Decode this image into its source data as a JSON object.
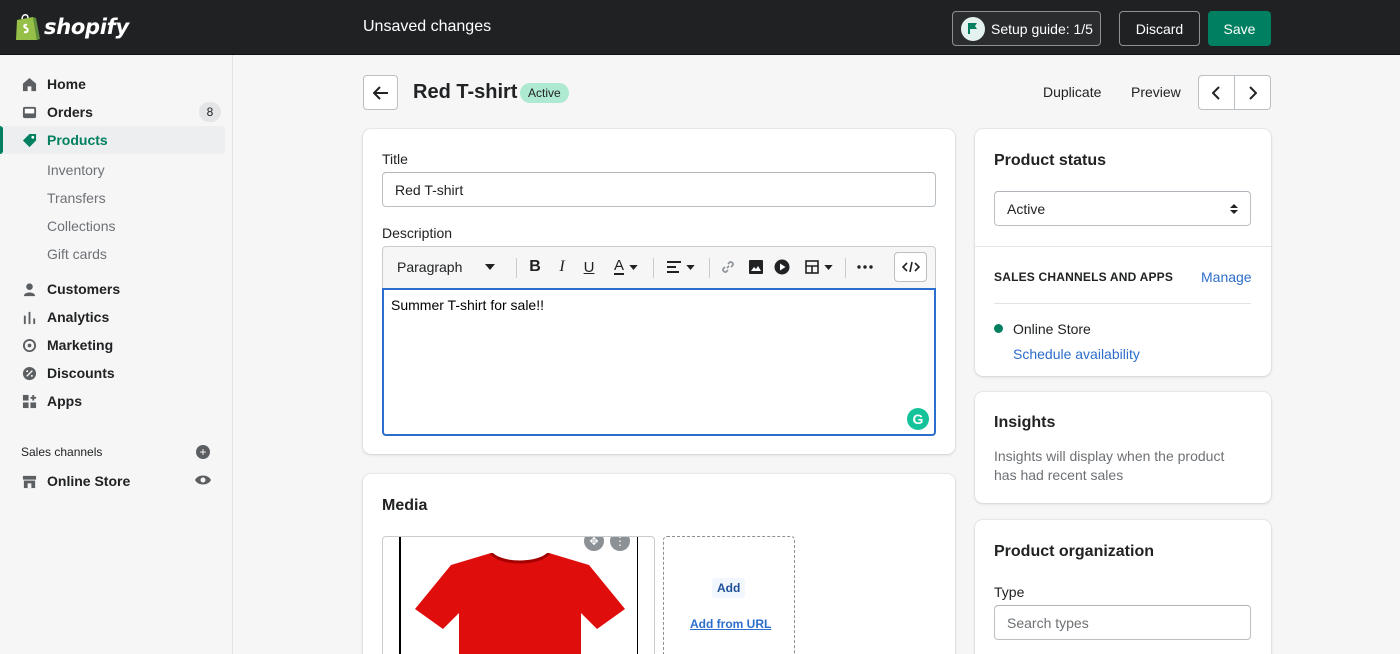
{
  "topbar": {
    "logo_text": "shopify",
    "title": "Unsaved changes",
    "setup_guide_label": "Setup guide: 1/5",
    "discard_label": "Discard",
    "save_label": "Save",
    "accent": "#008060"
  },
  "sidebar": {
    "items": [
      {
        "label": "Home",
        "icon": "home-icon"
      },
      {
        "label": "Orders",
        "icon": "orders-icon",
        "badge": "8"
      },
      {
        "label": "Products",
        "icon": "tag-icon",
        "active": true
      },
      {
        "label": "Customers",
        "icon": "person-icon"
      },
      {
        "label": "Analytics",
        "icon": "bar-chart-icon"
      },
      {
        "label": "Marketing",
        "icon": "target-icon"
      },
      {
        "label": "Discounts",
        "icon": "discount-icon"
      },
      {
        "label": "Apps",
        "icon": "apps-icon"
      }
    ],
    "sub_items": [
      "Inventory",
      "Transfers",
      "Collections",
      "Gift cards"
    ],
    "sales_channels_label": "Sales channels",
    "online_store_label": "Online Store"
  },
  "header": {
    "product_title": "Red T-shirt",
    "status_badge": "Active",
    "duplicate_label": "Duplicate",
    "preview_label": "Preview"
  },
  "main": {
    "title_label": "Title",
    "title_value": "Red T-shirt",
    "description_label": "Description",
    "paragraph_select": "Paragraph",
    "description_text": "Summer T-shirt for sale!!",
    "media_title": "Media",
    "add_label": "Add",
    "add_from_url_label": "Add from URL"
  },
  "side": {
    "product_status_title": "Product status",
    "status_value": "Active",
    "sales_channels_header": "SALES CHANNELS AND APPS",
    "manage_label": "Manage",
    "channel_name": "Online Store",
    "schedule_label": "Schedule availability",
    "insights_title": "Insights",
    "insights_text": "Insights will display when the product has had recent sales",
    "organization_title": "Product organization",
    "type_label": "Type",
    "type_placeholder": "Search types"
  }
}
